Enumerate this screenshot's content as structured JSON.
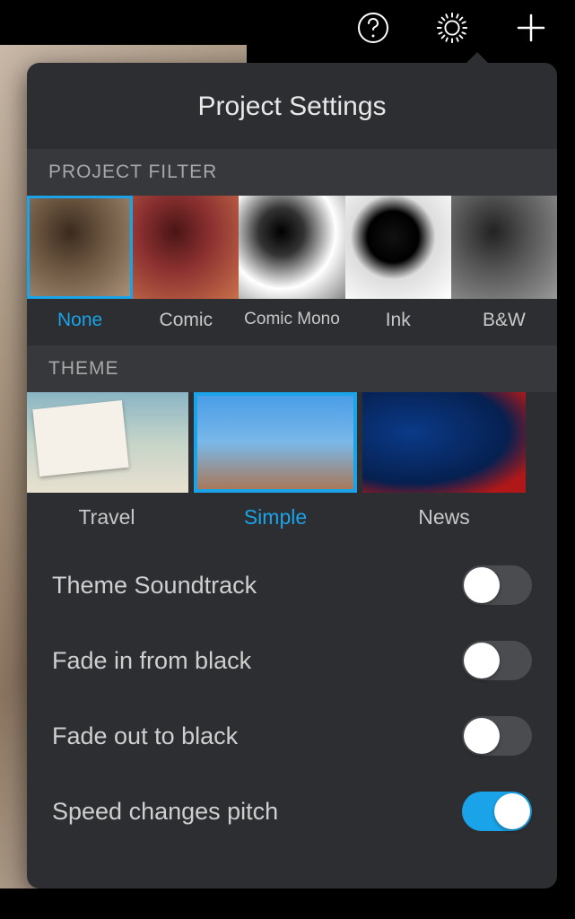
{
  "title": "Project Settings",
  "sections": {
    "filter_header": "PROJECT FILTER",
    "theme_header": "THEME"
  },
  "filters": [
    {
      "label": "None",
      "selected": true
    },
    {
      "label": "Comic",
      "selected": false
    },
    {
      "label": "Comic Mono",
      "selected": false
    },
    {
      "label": "Ink",
      "selected": false
    },
    {
      "label": "B&W",
      "selected": false
    }
  ],
  "themes": [
    {
      "label": "Travel",
      "selected": false
    },
    {
      "label": "Simple",
      "selected": true
    },
    {
      "label": "News",
      "selected": false
    }
  ],
  "toggles": {
    "soundtrack": {
      "label": "Theme Soundtrack",
      "on": false
    },
    "fade_in": {
      "label": "Fade in from black",
      "on": false
    },
    "fade_out": {
      "label": "Fade out to black",
      "on": false
    },
    "speed_pitch": {
      "label": "Speed changes pitch",
      "on": true
    }
  },
  "toolbar_icons": {
    "help": "help-icon",
    "settings": "gear-icon",
    "add": "plus-icon"
  }
}
